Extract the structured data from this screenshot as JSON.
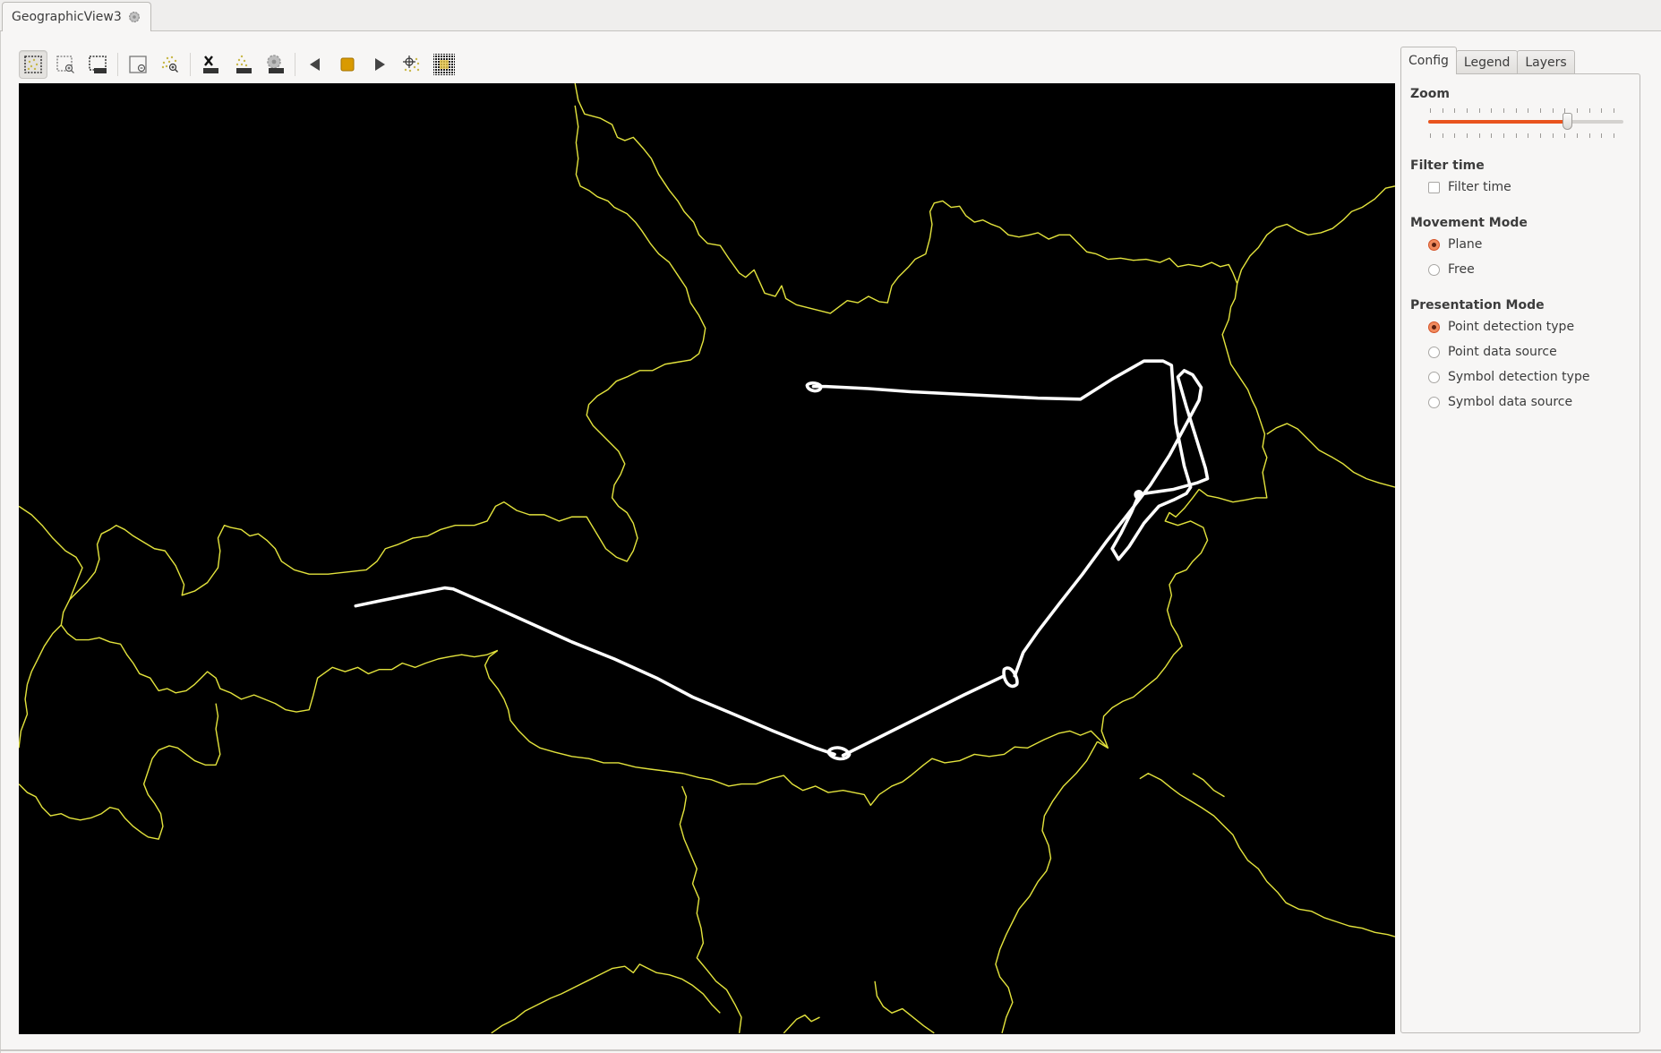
{
  "window": {
    "tab_title": "GeographicView3",
    "tab_icon": "gear-icon"
  },
  "toolbar": {
    "buttons": [
      {
        "name": "select-all-icon",
        "active": true
      },
      {
        "name": "zoom-to-selection-icon",
        "active": false
      },
      {
        "name": "select-label-icon",
        "active": false
      },
      {
        "name": "zoom-out-icon",
        "active": false
      },
      {
        "name": "zoom-to-points-icon",
        "active": false
      },
      {
        "name": "delete-label-icon",
        "active": false
      },
      {
        "name": "points-label-icon",
        "active": false
      },
      {
        "name": "settings-label-icon",
        "active": false
      },
      {
        "name": "previous-icon",
        "active": false
      },
      {
        "name": "stop-icon",
        "active": false
      },
      {
        "name": "next-icon",
        "active": false
      },
      {
        "name": "center-on-point-icon",
        "active": false
      },
      {
        "name": "grid-icon",
        "active": false
      }
    ]
  },
  "map": {
    "background": "#000000",
    "border_color": "#e8e84a",
    "track_color": "#ffffff"
  },
  "panel": {
    "tabs": [
      {
        "label": "Config",
        "active": true
      },
      {
        "label": "Legend",
        "active": false
      },
      {
        "label": "Layers",
        "active": false
      }
    ],
    "zoom": {
      "title": "Zoom",
      "value_fraction": 0.71,
      "tick_count": 16,
      "accent": "#e9541e"
    },
    "filter_time": {
      "title": "Filter time",
      "checkbox_label": "Filter time",
      "checked": false
    },
    "movement_mode": {
      "title": "Movement Mode",
      "options": [
        {
          "label": "Plane",
          "selected": true
        },
        {
          "label": "Free",
          "selected": false
        }
      ]
    },
    "presentation_mode": {
      "title": "Presentation Mode",
      "options": [
        {
          "label": "Point detection type",
          "selected": true
        },
        {
          "label": "Point data source",
          "selected": false
        },
        {
          "label": "Symbol detection type",
          "selected": false
        },
        {
          "label": "Symbol data source",
          "selected": false
        }
      ]
    }
  }
}
